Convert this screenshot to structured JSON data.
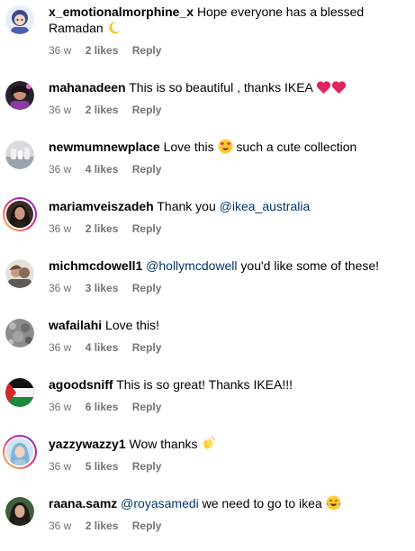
{
  "colors": {
    "username": "#000000",
    "text": "#000000",
    "mention": "#00376b",
    "meta": "#737373",
    "heart": "#e0245e"
  },
  "comments": [
    {
      "username": "x_emotionalmorphine_x",
      "text": "Hope everyone has a blessed Ramadan",
      "emoji": "crescent-moon",
      "time": "36 w",
      "likes": "2 likes",
      "reply": "Reply"
    },
    {
      "username": "mahanadeen",
      "text": "This is so beautiful , thanks IKEA",
      "emoji": "two-red-hearts",
      "time": "36 w",
      "likes": "2 likes",
      "reply": "Reply"
    },
    {
      "username": "newmumnewplace",
      "text_before": "Love this",
      "emoji": "heart-eyes-face",
      "text_after": "such a cute collection",
      "time": "36 w",
      "likes": "4 likes",
      "reply": "Reply"
    },
    {
      "username": "mariamveiszadeh",
      "text": "Thank you",
      "mention": "@ikea_australia",
      "time": "36 w",
      "likes": "2 likes",
      "reply": "Reply"
    },
    {
      "username": "michmcdowell1",
      "mention": "@hollymcdowell",
      "text": "you'd like some of these!",
      "time": "36 w",
      "likes": "3 likes",
      "reply": "Reply"
    },
    {
      "username": "wafailahi",
      "text": "Love this!",
      "time": "36 w",
      "likes": "4 likes",
      "reply": "Reply"
    },
    {
      "username": "agoodsniff",
      "text": "This is so great! Thanks IKEA!!!",
      "time": "36 w",
      "likes": "6 likes",
      "reply": "Reply"
    },
    {
      "username": "yazzywazzy1",
      "text": "Wow thanks",
      "emoji": "clapping-hands",
      "time": "36 w",
      "likes": "5 likes",
      "reply": "Reply"
    },
    {
      "username": "raana.samz",
      "mention": "@royasamedi",
      "text": "we need to go to ikea",
      "emoji": "tears-of-joy-face",
      "time": "36 w",
      "likes": "2 likes",
      "reply": "Reply"
    }
  ]
}
